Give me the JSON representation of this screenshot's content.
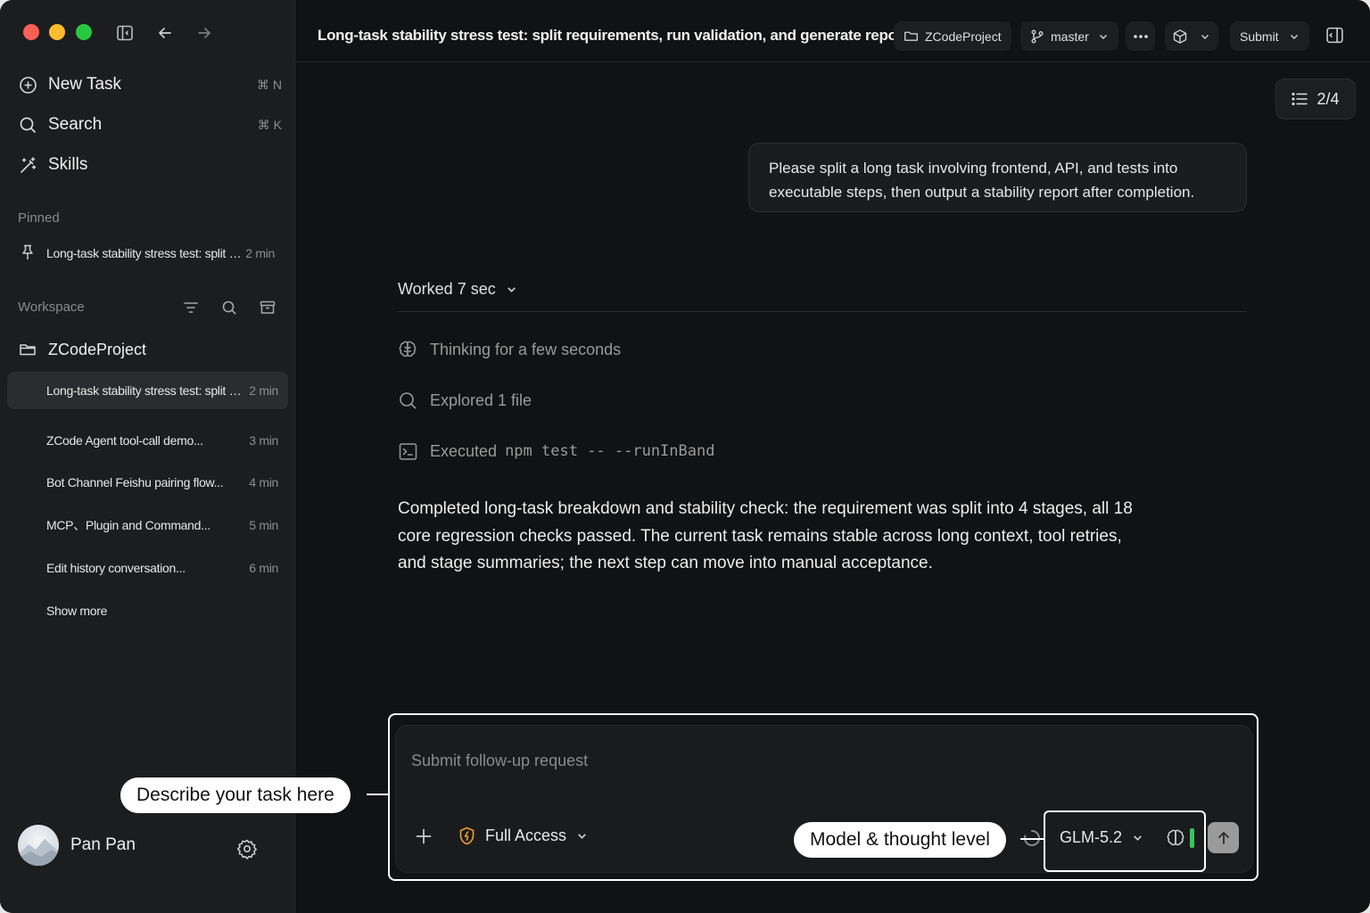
{
  "sidebar": {
    "nav": [
      {
        "label": "New Task",
        "shortcut": "⌘ N",
        "icon": "plus-circle-icon"
      },
      {
        "label": "Search",
        "shortcut": "⌘ K",
        "icon": "search-icon"
      },
      {
        "label": "Skills",
        "shortcut": "",
        "icon": "magic-wand-icon"
      }
    ],
    "pinned_label": "Pinned",
    "pinned": [
      {
        "title": "Long-task stability stress test: split requ...",
        "time": "2 min"
      }
    ],
    "workspace_label": "Workspace",
    "project": "ZCodeProject",
    "threads": [
      {
        "title": "Long-task stability stress test: split requ...",
        "time": "2 min"
      },
      {
        "title": "ZCode Agent tool-call demo...",
        "time": "3 min"
      },
      {
        "title": "Bot Channel Feishu pairing flow...",
        "time": "4 min"
      },
      {
        "title": "MCP、Plugin and Command...",
        "time": "5 min"
      },
      {
        "title": "Edit history conversation...",
        "time": "6 min"
      }
    ],
    "show_more": "Show more",
    "user_name": "Pan Pan"
  },
  "topbar": {
    "title": "Long-task stability stress test: split requirements, run validation, and generate report",
    "project": "ZCodeProject",
    "branch": "master",
    "submit": "Submit"
  },
  "progress": "2/4",
  "conversation": {
    "user_message": "Please split a long task involving frontend, API, and tests into executable steps, then output a stability report after completion.",
    "worked": "Worked 7 sec",
    "steps": [
      {
        "icon": "brain-icon",
        "text": "Thinking for a few seconds"
      },
      {
        "icon": "search-icon",
        "text": "Explored 1 file"
      },
      {
        "icon": "terminal-icon",
        "prefix": "Executed",
        "code": "npm test -- --runInBand"
      }
    ],
    "answer": "Completed long-task breakdown and stability check: the requirement was split into 4 stages, all 18 core regression checks passed. The current task remains stable across long context, tool retries, and stage summaries; the next step can move into manual acceptance."
  },
  "composer": {
    "placeholder": "Submit follow-up request",
    "access": "Full Access",
    "model": "GLM-5.2"
  },
  "callouts": {
    "task": "Describe your task here",
    "model": "Model & thought level"
  },
  "colors": {
    "window_bg": "#111213",
    "sidebar_bg": "#1c1d1f",
    "traffic_red": "#fe5f57",
    "traffic_yellow": "#febc2e",
    "traffic_green": "#28c840",
    "access_shield": "#f0a030",
    "thought_level": "#34c759"
  }
}
